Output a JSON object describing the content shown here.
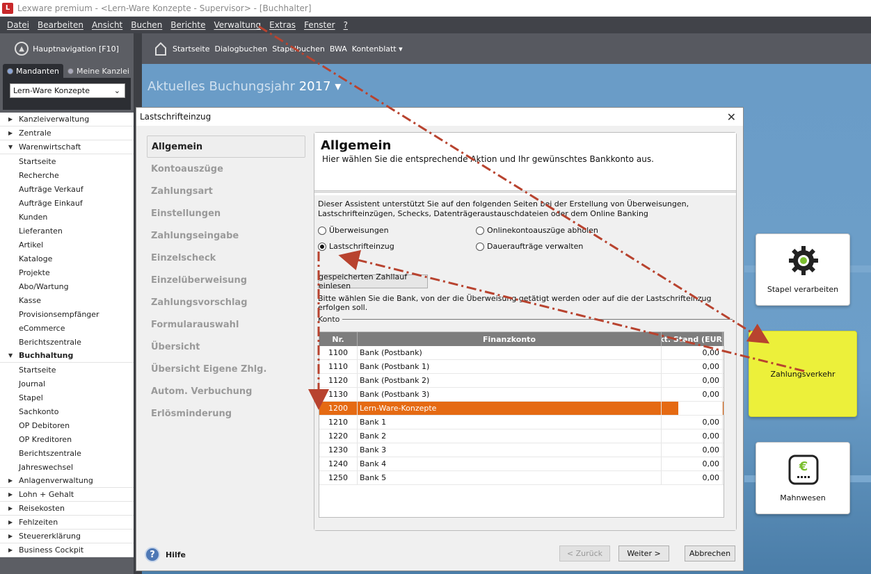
{
  "window": {
    "title": "Lexware premium - <Lern-Ware Konzepte - Supervisor> - [Buchhalter]",
    "logo": "L"
  },
  "menu": [
    "Datei",
    "Bearbeiten",
    "Ansicht",
    "Buchen",
    "Berichte",
    "Verwaltung",
    "Extras",
    "Fenster",
    "?"
  ],
  "sidebar": {
    "hauptnav": "Hauptnavigation [F10]",
    "tab_mandanten": "Mandanten",
    "tab_kanzlei": "Meine Kanzlei",
    "selected_mandant": "Lern-Ware Konzepte",
    "tree": [
      {
        "label": "Kanzleiverwaltung",
        "type": "group",
        "expanded": false
      },
      {
        "label": "Zentrale",
        "type": "group",
        "expanded": false
      },
      {
        "label": "Warenwirtschaft",
        "type": "group",
        "expanded": true
      },
      {
        "label": "Startseite",
        "type": "sub"
      },
      {
        "label": "Recherche",
        "type": "sub"
      },
      {
        "label": "Aufträge Verkauf",
        "type": "sub"
      },
      {
        "label": "Aufträge Einkauf",
        "type": "sub"
      },
      {
        "label": "Kunden",
        "type": "sub"
      },
      {
        "label": "Lieferanten",
        "type": "sub"
      },
      {
        "label": "Artikel",
        "type": "sub"
      },
      {
        "label": "Kataloge",
        "type": "sub"
      },
      {
        "label": "Projekte",
        "type": "sub"
      },
      {
        "label": "Abo/Wartung",
        "type": "sub"
      },
      {
        "label": "Kasse",
        "type": "sub"
      },
      {
        "label": "Provisionsempfänger",
        "type": "sub"
      },
      {
        "label": "eCommerce",
        "type": "sub"
      },
      {
        "label": "Berichtszentrale",
        "type": "sub"
      },
      {
        "label": "Buchhaltung",
        "type": "group",
        "expanded": true,
        "bold": true
      },
      {
        "label": "Startseite",
        "type": "sub"
      },
      {
        "label": "Journal",
        "type": "sub"
      },
      {
        "label": "Stapel",
        "type": "sub"
      },
      {
        "label": "Sachkonto",
        "type": "sub"
      },
      {
        "label": "OP Debitoren",
        "type": "sub"
      },
      {
        "label": "OP Kreditoren",
        "type": "sub"
      },
      {
        "label": "Berichtszentrale",
        "type": "sub"
      },
      {
        "label": "Jahreswechsel",
        "type": "sub"
      },
      {
        "label": "Anlagenverwaltung",
        "type": "group",
        "expanded": false
      },
      {
        "label": "Lohn + Gehalt",
        "type": "group",
        "expanded": false
      },
      {
        "label": "Reisekosten",
        "type": "group",
        "expanded": false
      },
      {
        "label": "Fehlzeiten",
        "type": "group",
        "expanded": false
      },
      {
        "label": "Steuererklärung",
        "type": "group",
        "expanded": false
      },
      {
        "label": "Business Cockpit",
        "type": "group",
        "expanded": false
      }
    ]
  },
  "ribbon": {
    "items": [
      "Startseite",
      "Dialogbuchen",
      "Stapelbuchen",
      "BWA",
      "Kontenblatt ▾"
    ]
  },
  "main": {
    "jahr_label": "Aktuelles Buchungsjahr",
    "jahr_value": "2017 ▾"
  },
  "tiles": {
    "stapel": "Stapel verarbeiten",
    "zahlung": "Zahlungsverkehr",
    "mahn": "Mahnwesen"
  },
  "dialog": {
    "title": "Lastschrifteinzug",
    "close": "✕",
    "steps": [
      "Allgemein",
      "Kontoauszüge",
      "Zahlungsart",
      "Einstellungen",
      "Zahlungseingabe",
      "Einzelscheck",
      "Einzelüberweisung",
      "Zahlungsvorschlag",
      "Formularauswahl",
      "Übersicht",
      "Übersicht Eigene Zhlg.",
      "Autom. Verbuchung",
      "Erlösminderung"
    ],
    "active_step": 0,
    "content_title": "Allgemein",
    "content_sub": "Hier wählen Sie die entsprechende Aktion und Ihr gewünschtes Bankkonto aus.",
    "intro": "Dieser Assistent unterstützt Sie auf den folgenden Seiten bei der Erstellung von Überweisungen, Lastschrifteinzügen, Schecks, Datenträgeraustauschdateien oder dem Online Banking",
    "options": {
      "ueberweisungen": "Überweisungen",
      "online": "Onlinekontoauszüge abholen",
      "lastschrift": "Lastschrifteinzug",
      "dauer": "Daueraufträge verwalten"
    },
    "selected_option": "lastschrift",
    "btn_gespeichert": "gespeicherten Zahllauf einlesen",
    "bank_prompt": "Bitte wählen Sie die Bank, von der die Überweisung getätigt werden oder auf die der Lastschrifteinzug erfolgen soll.",
    "konto_label": "Konto",
    "table": {
      "headers": {
        "nr": "Nr.",
        "name": "Finanzkonto",
        "stand": "akt. Stand (EUR"
      },
      "rows": [
        {
          "nr": "1100",
          "name": "Bank (Postbank)",
          "stand": "0,00"
        },
        {
          "nr": "1110",
          "name": "Bank (Postbank 1)",
          "stand": "0,00"
        },
        {
          "nr": "1120",
          "name": "Bank (Postbank 2)",
          "stand": "0,00"
        },
        {
          "nr": "1130",
          "name": "Bank (Postbank 3)",
          "stand": "0,00"
        },
        {
          "nr": "1200",
          "name": "Lern-Ware-Konzepte",
          "stand": "",
          "selected": true
        },
        {
          "nr": "1210",
          "name": "Bank 1",
          "stand": "0,00"
        },
        {
          "nr": "1220",
          "name": "Bank 2",
          "stand": "0,00"
        },
        {
          "nr": "1230",
          "name": "Bank 3",
          "stand": "0,00"
        },
        {
          "nr": "1240",
          "name": "Bank 4",
          "stand": "0,00"
        },
        {
          "nr": "1250",
          "name": "Bank 5",
          "stand": "0,00"
        }
      ]
    },
    "footer": {
      "help_icon": "?",
      "help": "Hilfe",
      "back": "< Zurück",
      "next": "Weiter >",
      "cancel": "Abbrechen"
    }
  },
  "colors": {
    "selection": "#e56a13",
    "annotation_arrow": "#b8432f",
    "tile_highlight": "#ecf03a"
  }
}
